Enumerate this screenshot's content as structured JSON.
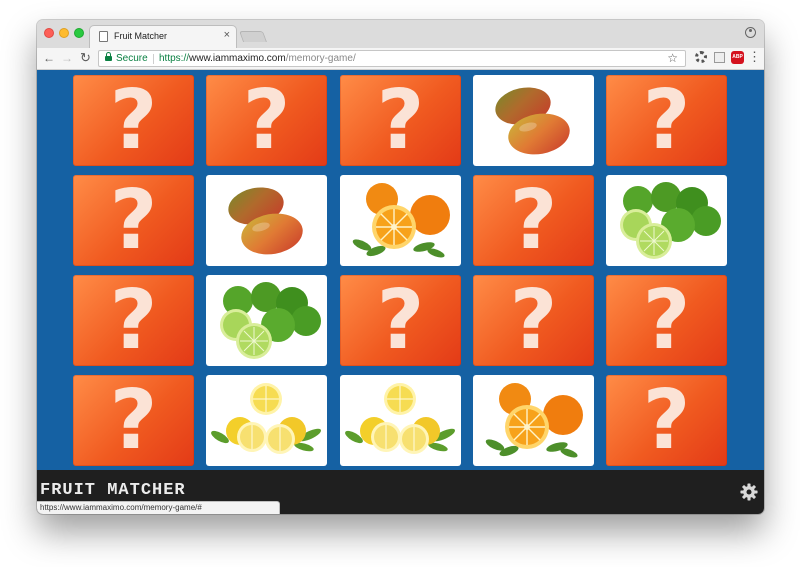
{
  "browser": {
    "tab_title": "Fruit Matcher",
    "tab_close": "×",
    "secure_label": "Secure",
    "url_scheme": "https://",
    "url_host": "www.iammaximo.com",
    "url_path": "/memory-game/",
    "status_url": "https://www.iammaximo.com/memory-game/#",
    "abp_label": "ABP"
  },
  "game": {
    "title": "FRUIT MATCHER",
    "hidden_symbol": "?",
    "colors": {
      "board": "#1561a3",
      "card_face": "#f05a20",
      "footer": "#1f1f1f"
    },
    "rows": [
      [
        "hidden",
        "hidden",
        "hidden",
        "mango",
        "hidden"
      ],
      [
        "hidden",
        "mango",
        "orange",
        "hidden",
        "lime"
      ],
      [
        "hidden",
        "lime",
        "hidden",
        "hidden",
        "hidden"
      ],
      [
        "hidden",
        "lemon",
        "lemon",
        "orange",
        "hidden"
      ]
    ]
  }
}
